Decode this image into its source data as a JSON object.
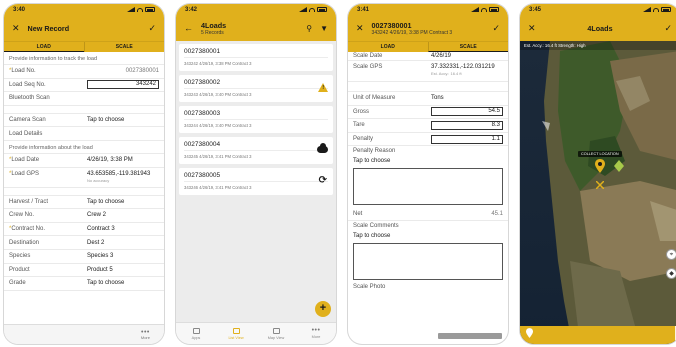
{
  "colors": {
    "accent": "#e0b01c",
    "text": "#1a1a1a",
    "muted": "#777777"
  },
  "screen1": {
    "time": "3:40",
    "title": "New Record",
    "tabs": [
      "LOAD",
      "SCALE"
    ],
    "hint_track": "Provide information to track the load",
    "load_no_label": "Load No.",
    "load_no_value": "0027380001",
    "load_seq_label": "Load Seq No.",
    "load_seq_value": "343242",
    "bluetooth_label": "Bluetooth Scan",
    "camera_label": "Camera Scan",
    "camera_value": "Tap to choose",
    "load_details_label": "Load Details",
    "hint_about": "Provide information about the load",
    "load_date_label": "Load Date",
    "load_date_value": "4/26/19, 3:38 PM",
    "load_gps_label": "Load GPS",
    "load_gps_value": "43.653585,-119.381943",
    "load_gps_acc": "No accuracy",
    "harvest_label": "Harvest / Tract",
    "harvest_value": "Tap to choose",
    "crew_label": "Crew No.",
    "crew_value": "Crew 2",
    "contract_label": "Contract No.",
    "contract_value": "Contract 3",
    "destination_label": "Destination",
    "destination_value": "Dest 2",
    "species_label": "Species",
    "species_value": "Species 3",
    "product_label": "Product",
    "product_value": "Product 5",
    "grade_label": "Grade",
    "grade_value": "Tap to choose",
    "more_label": "More"
  },
  "screen2": {
    "time": "3:42",
    "title": "4Loads",
    "subtitle": "5 Records",
    "cards": [
      {
        "num": "0027380001",
        "meta": "343242  4/26/19, 3:38 PM  Contract 3"
      },
      {
        "num": "0027380002",
        "meta": "343243  4/26/19, 3:40 PM  Contract 3"
      },
      {
        "num": "0027380003",
        "meta": "343244  4/26/19, 3:40 PM  Contract 3"
      },
      {
        "num": "0027380004",
        "meta": "343245  4/26/19, 3:41 PM  Contract 3"
      },
      {
        "num": "0027380005",
        "meta": "343246  4/26/19, 3:41 PM  Contract 3"
      }
    ],
    "tabbar": [
      "Apps",
      "List View",
      "Map View",
      "More"
    ]
  },
  "screen3": {
    "time": "3:41",
    "title": "0027380001",
    "subtitle": "343242  4/26/19, 3:38 PM  Contract 3",
    "tabs": [
      "LOAD",
      "SCALE"
    ],
    "scale_date_label": "Scale Date",
    "scale_date_value": "4/26/19",
    "scale_gps_label": "Scale GPS",
    "scale_gps_value": "37.332331,-122.031219",
    "scale_gps_acc": "Est. Accy.: 16.4 ft",
    "uom_label": "Unit of Measure",
    "uom_value": "Tons",
    "gross_label": "Gross",
    "gross_value": "54.5",
    "tare_label": "Tare",
    "tare_value": "8.3",
    "penalty_label": "Penalty",
    "penalty_value": "1.1",
    "penalty_reason_label": "Penalty Reason",
    "penalty_reason_value": "Tap to choose",
    "net_label": "Net",
    "net_value": "45.1",
    "scale_comments_label": "Scale Comments",
    "scale_comments_value": "Tap to choose",
    "scale_photo_label": "Scale Photo"
  },
  "screen4": {
    "time": "3:45",
    "title": "4Loads",
    "map_info": "Est. Accy.: 16.4 ft   Strength: High",
    "pin_label": "COLLECT LOCATION"
  }
}
